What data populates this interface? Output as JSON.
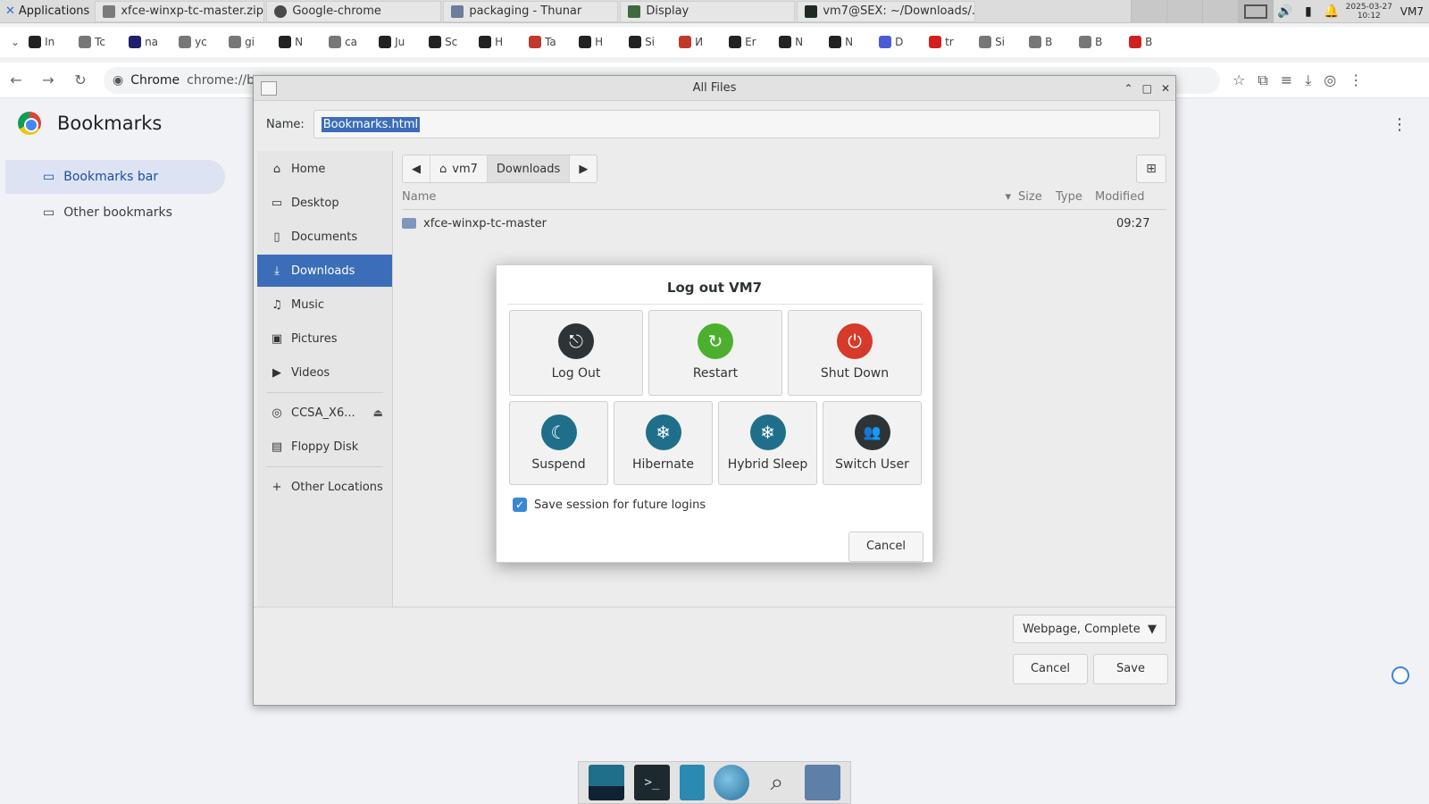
{
  "taskbar": {
    "apps_label": "Applications",
    "tasks": [
      {
        "label": "xfce-winxp-tc-master.zip ...",
        "color": "#7b7b7b"
      },
      {
        "label": "Google-chrome",
        "color": "#4a4a4a"
      },
      {
        "label": "packaging - Thunar",
        "color": "#6b7e9a"
      },
      {
        "label": "Display",
        "color": "#3f6a3f"
      },
      {
        "label": "vm7@SEX: ~/Downloads/...",
        "color": "#1f2b22"
      }
    ],
    "clock_date": "2025-03-27",
    "clock_time": "10:12",
    "user": "VM7"
  },
  "bookmarks_strip": [
    {
      "label": "In",
      "color": "#222"
    },
    {
      "label": "Tc",
      "color": "#777"
    },
    {
      "label": "na",
      "color": "#1f1f6b"
    },
    {
      "label": "yc",
      "color": "#777"
    },
    {
      "label": "gi",
      "color": "#777"
    },
    {
      "label": "N",
      "color": "#222"
    },
    {
      "label": "ca",
      "color": "#777"
    },
    {
      "label": "Ju",
      "color": "#222"
    },
    {
      "label": "Sc",
      "color": "#222"
    },
    {
      "label": "H",
      "color": "#222"
    },
    {
      "label": "Ta",
      "color": "#c0392b"
    },
    {
      "label": "H",
      "color": "#222"
    },
    {
      "label": "Si",
      "color": "#222"
    },
    {
      "label": "И",
      "color": "#c0392b"
    },
    {
      "label": "Er",
      "color": "#222"
    },
    {
      "label": "N",
      "color": "#222"
    },
    {
      "label": "N",
      "color": "#222"
    },
    {
      "label": "D",
      "color": "#4b5bd6"
    },
    {
      "label": "tr",
      "color": "#d21f1f"
    },
    {
      "label": "Si",
      "color": "#777"
    },
    {
      "label": "B",
      "color": "#777"
    },
    {
      "label": "B",
      "color": "#777"
    },
    {
      "label": "B",
      "color": "#d21f1f"
    }
  ],
  "omnibox": {
    "chip": "Chrome",
    "url": "chrome://b"
  },
  "bookmarks_page": {
    "title": "Bookmarks",
    "folders": [
      "Bookmarks bar",
      "Other bookmarks"
    ]
  },
  "file_dialog": {
    "title": "All Files",
    "name_label": "Name:",
    "name_value": "Bookmarks.html",
    "places": [
      {
        "label": "Home",
        "icon": "⌂"
      },
      {
        "label": "Desktop",
        "icon": "▭"
      },
      {
        "label": "Documents",
        "icon": "▯"
      },
      {
        "label": "Downloads",
        "icon": "⤓"
      },
      {
        "label": "Music",
        "icon": "♫"
      },
      {
        "label": "Pictures",
        "icon": "▣"
      },
      {
        "label": "Videos",
        "icon": "▶"
      },
      {
        "label": "CCSA_X6...",
        "icon": "◎"
      },
      {
        "label": "Floppy Disk",
        "icon": "▤"
      },
      {
        "label": "Other Locations",
        "icon": "+"
      }
    ],
    "path": [
      "vm7",
      "Downloads"
    ],
    "columns": [
      "Name",
      "Size",
      "Type",
      "Modified"
    ],
    "rows": [
      {
        "name": "xfce-winxp-tc-master",
        "modified": "09:27"
      }
    ],
    "filter": "Webpage, Complete",
    "cancel": "Cancel",
    "save": "Save"
  },
  "logout_dialog": {
    "title": "Log out VM7",
    "buttons_top": [
      {
        "label": "Log Out",
        "color": "#2e3436",
        "glyph": "⎋"
      },
      {
        "label": "Restart",
        "color": "#4caf2e",
        "glyph": "↻"
      },
      {
        "label": "Shut Down",
        "color": "#d63a2a",
        "glyph": "⏻"
      }
    ],
    "buttons_bottom": [
      {
        "label": "Suspend",
        "color": "#1f6f8b",
        "glyph": "☾"
      },
      {
        "label": "Hibernate",
        "color": "#1f6f8b",
        "glyph": "❄"
      },
      {
        "label": "Hybrid Sleep",
        "color": "#1f6f8b",
        "glyph": "❄"
      },
      {
        "label": "Switch User",
        "color": "#2e3436",
        "glyph": "👥"
      }
    ],
    "save_session": "Save session for future logins",
    "cancel": "Cancel"
  }
}
